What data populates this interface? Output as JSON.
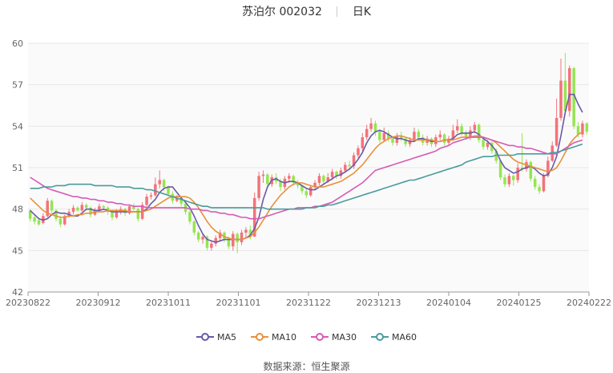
{
  "header": {
    "name": "苏泊尔 002032",
    "period": "日K"
  },
  "source": {
    "label": "数据来源：",
    "value": "恒生聚源"
  },
  "colors": {
    "up": "#f4727a",
    "down": "#95e550",
    "grid": "#e8e8e8",
    "ma5": "#6a5aa8",
    "ma10": "#e8913a",
    "ma30": "#d65bb6",
    "ma60": "#4a9c9c"
  },
  "chart_data": {
    "type": "candlestick",
    "ylim": [
      42,
      60
    ],
    "yticks": [
      "42",
      "45",
      "48",
      "51",
      "54",
      "57",
      "60"
    ],
    "xticks": [
      "20230822",
      "20230912",
      "20231011",
      "20231101",
      "20231122",
      "20231213",
      "20240104",
      "20240125",
      "20240222"
    ],
    "candles": [
      [
        47.9,
        47.3,
        48.0,
        47.1
      ],
      [
        47.4,
        47.1,
        47.6,
        46.9
      ],
      [
        47.2,
        46.9,
        47.4,
        46.8
      ],
      [
        47.0,
        47.5,
        47.7,
        46.9
      ],
      [
        47.5,
        48.6,
        48.8,
        47.4
      ],
      [
        48.6,
        47.9,
        48.7,
        47.7
      ],
      [
        47.9,
        47.3,
        48.0,
        47.1
      ],
      [
        47.3,
        46.9,
        47.5,
        46.7
      ],
      [
        46.9,
        47.5,
        47.6,
        46.8
      ],
      [
        47.5,
        47.8,
        48.0,
        47.4
      ],
      [
        47.8,
        48.1,
        48.3,
        47.6
      ],
      [
        48.1,
        47.9,
        48.2,
        47.8
      ],
      [
        47.9,
        48.3,
        48.5,
        47.8
      ],
      [
        48.3,
        48.1,
        48.4,
        47.9
      ],
      [
        48.1,
        47.6,
        48.2,
        47.4
      ],
      [
        47.6,
        47.9,
        48.1,
        47.5
      ],
      [
        47.9,
        48.2,
        48.4,
        47.8
      ],
      [
        48.2,
        48.1,
        48.3,
        47.9
      ],
      [
        48.1,
        47.8,
        48.2,
        47.6
      ],
      [
        47.8,
        47.4,
        47.9,
        47.2
      ],
      [
        47.4,
        47.8,
        48.0,
        47.3
      ],
      [
        47.8,
        48.0,
        48.2,
        47.6
      ],
      [
        48.0,
        47.7,
        48.1,
        47.5
      ],
      [
        47.7,
        48.2,
        48.3,
        47.6
      ],
      [
        48.2,
        48.0,
        48.4,
        47.9
      ],
      [
        48.0,
        47.3,
        48.1,
        47.1
      ],
      [
        47.3,
        48.3,
        48.5,
        47.2
      ],
      [
        48.3,
        48.9,
        49.1,
        48.1
      ],
      [
        48.9,
        49.0,
        49.2,
        48.7
      ],
      [
        49.0,
        49.8,
        50.3,
        48.9
      ],
      [
        49.8,
        50.1,
        50.8,
        49.5
      ],
      [
        50.1,
        49.6,
        50.2,
        49.3
      ],
      [
        49.6,
        49.1,
        49.7,
        48.9
      ],
      [
        49.1,
        48.6,
        49.3,
        48.4
      ],
      [
        48.6,
        48.8,
        49.0,
        48.5
      ],
      [
        48.8,
        48.4,
        48.9,
        48.2
      ],
      [
        48.4,
        47.8,
        48.5,
        47.6
      ],
      [
        47.8,
        47.1,
        47.9,
        46.9
      ],
      [
        47.1,
        46.3,
        47.2,
        46.1
      ],
      [
        46.3,
        45.8,
        46.4,
        45.6
      ],
      [
        45.8,
        46.0,
        46.2,
        45.5
      ],
      [
        46.0,
        45.2,
        46.1,
        45.0
      ],
      [
        45.2,
        45.5,
        45.7,
        45.0
      ],
      [
        45.5,
        45.9,
        46.1,
        45.3
      ],
      [
        45.9,
        46.3,
        46.5,
        45.7
      ],
      [
        46.3,
        45.8,
        46.4,
        45.6
      ],
      [
        45.8,
        45.3,
        46.0,
        45.1
      ],
      [
        45.3,
        46.2,
        46.4,
        45.0
      ],
      [
        46.2,
        45.6,
        46.3,
        44.8
      ],
      [
        45.6,
        46.3,
        46.5,
        45.4
      ],
      [
        46.3,
        46.5,
        46.7,
        45.9
      ],
      [
        46.5,
        46.0,
        46.8,
        45.8
      ],
      [
        46.0,
        48.8,
        49.2,
        46.0
      ],
      [
        48.8,
        50.4,
        50.7,
        48.6
      ],
      [
        50.4,
        50.5,
        50.8,
        49.9
      ],
      [
        50.5,
        49.8,
        50.6,
        49.5
      ],
      [
        49.8,
        50.3,
        50.5,
        49.6
      ],
      [
        50.3,
        50.0,
        50.6,
        49.8
      ],
      [
        50.0,
        49.6,
        50.2,
        49.3
      ],
      [
        49.6,
        50.2,
        50.4,
        49.4
      ],
      [
        50.2,
        50.4,
        50.6,
        49.9
      ],
      [
        50.4,
        49.9,
        50.5,
        49.7
      ],
      [
        49.9,
        49.7,
        50.1,
        49.5
      ],
      [
        49.7,
        49.3,
        49.8,
        49.1
      ],
      [
        49.3,
        49.0,
        49.5,
        48.8
      ],
      [
        49.0,
        49.6,
        49.7,
        48.9
      ],
      [
        49.6,
        49.9,
        50.1,
        49.4
      ],
      [
        49.9,
        50.4,
        50.6,
        49.7
      ],
      [
        50.4,
        50.0,
        50.5,
        49.8
      ],
      [
        50.0,
        50.3,
        50.6,
        49.9
      ],
      [
        50.3,
        50.7,
        50.9,
        50.1
      ],
      [
        50.7,
        50.4,
        50.8,
        50.2
      ],
      [
        50.4,
        50.8,
        51.0,
        50.2
      ],
      [
        50.8,
        51.2,
        51.4,
        50.6
      ],
      [
        51.2,
        51.1,
        51.5,
        50.9
      ],
      [
        51.1,
        51.9,
        52.1,
        50.9
      ],
      [
        51.9,
        52.4,
        52.6,
        51.7
      ],
      [
        52.4,
        53.2,
        53.5,
        52.2
      ],
      [
        53.2,
        53.8,
        54.1,
        53.0
      ],
      [
        53.8,
        54.2,
        54.6,
        53.6
      ],
      [
        54.2,
        53.6,
        54.4,
        53.3
      ],
      [
        53.6,
        53.0,
        53.8,
        52.8
      ],
      [
        53.0,
        53.5,
        53.9,
        52.9
      ],
      [
        53.5,
        53.1,
        53.7,
        52.9
      ],
      [
        53.1,
        52.8,
        53.3,
        52.6
      ],
      [
        52.8,
        53.3,
        53.5,
        52.6
      ],
      [
        53.3,
        53.1,
        53.6,
        52.9
      ],
      [
        53.1,
        52.7,
        53.2,
        52.5
      ],
      [
        52.7,
        53.0,
        53.2,
        52.5
      ],
      [
        53.0,
        53.6,
        53.9,
        52.9
      ],
      [
        53.6,
        53.2,
        53.8,
        53.0
      ],
      [
        53.2,
        52.8,
        53.4,
        52.6
      ],
      [
        52.8,
        53.1,
        53.3,
        52.6
      ],
      [
        53.1,
        52.7,
        53.2,
        52.5
      ],
      [
        52.7,
        53.2,
        53.4,
        52.5
      ],
      [
        53.2,
        53.4,
        53.7,
        53.0
      ],
      [
        53.4,
        52.8,
        53.5,
        52.6
      ],
      [
        52.8,
        53.1,
        53.3,
        52.6
      ],
      [
        53.1,
        53.7,
        54.1,
        53.0
      ],
      [
        53.7,
        54.0,
        54.5,
        53.5
      ],
      [
        54.0,
        53.5,
        54.2,
        53.3
      ],
      [
        53.5,
        53.2,
        53.7,
        53.0
      ],
      [
        53.2,
        53.7,
        54.0,
        53.0
      ],
      [
        53.7,
        54.1,
        54.3,
        53.5
      ],
      [
        54.1,
        53.0,
        54.2,
        52.8
      ],
      [
        53.0,
        52.5,
        53.2,
        52.3
      ],
      [
        52.5,
        52.8,
        53.0,
        52.3
      ],
      [
        52.8,
        52.2,
        52.9,
        52.0
      ],
      [
        52.2,
        51.5,
        52.4,
        51.3
      ],
      [
        51.5,
        50.3,
        51.6,
        50.1
      ],
      [
        50.3,
        49.8,
        50.5,
        49.6
      ],
      [
        49.8,
        50.4,
        50.6,
        49.6
      ],
      [
        50.4,
        50.1,
        50.5,
        49.7
      ],
      [
        50.1,
        51.0,
        51.3,
        49.9
      ],
      [
        51.0,
        50.9,
        53.5,
        50.7
      ],
      [
        50.9,
        51.4,
        51.6,
        50.7
      ],
      [
        51.4,
        50.2,
        51.5,
        50.0
      ],
      [
        50.2,
        49.6,
        50.4,
        49.4
      ],
      [
        49.6,
        49.3,
        49.8,
        49.1
      ],
      [
        49.3,
        50.4,
        50.6,
        49.2
      ],
      [
        50.4,
        51.5,
        51.8,
        50.3
      ],
      [
        51.5,
        52.6,
        52.9,
        51.4
      ],
      [
        52.6,
        54.6,
        56.0,
        52.5
      ],
      [
        54.6,
        57.3,
        58.9,
        54.4
      ],
      [
        57.3,
        55.1,
        59.3,
        54.9
      ],
      [
        55.1,
        58.2,
        58.4,
        54.7
      ],
      [
        58.2,
        54.0,
        58.3,
        53.8
      ],
      [
        54.0,
        53.4,
        54.3,
        53.2
      ],
      [
        53.4,
        54.2,
        54.4,
        53.2
      ],
      [
        54.2,
        53.6,
        54.3,
        53.4
      ]
    ],
    "series": [
      {
        "name": "MA5",
        "values": [
          47.9,
          47.6,
          47.3,
          47.2,
          47.3,
          47.6,
          47.8,
          47.7,
          47.7,
          47.6,
          47.5,
          47.5,
          47.7,
          48.0,
          48.0,
          47.9,
          47.9,
          48.0,
          47.9,
          47.8,
          47.8,
          47.8,
          47.8,
          47.8,
          47.8,
          47.8,
          47.8,
          48.0,
          48.4,
          48.7,
          49.2,
          49.5,
          49.6,
          49.6,
          49.2,
          48.8,
          48.5,
          48.1,
          47.5,
          46.8,
          46.2,
          45.8,
          45.7,
          45.6,
          45.7,
          45.8,
          45.8,
          45.8,
          45.8,
          45.8,
          45.9,
          46.1,
          46.6,
          47.4,
          48.7,
          49.6,
          50.1,
          50.2,
          50.0,
          49.9,
          50.0,
          50.0,
          49.9,
          49.7,
          49.5,
          49.4,
          49.4,
          49.6,
          49.8,
          50.0,
          50.2,
          50.4,
          50.5,
          50.7,
          50.9,
          51.2,
          51.6,
          52.1,
          52.8,
          53.3,
          53.6,
          53.7,
          53.6,
          53.4,
          53.2,
          53.1,
          53.1,
          53.0,
          52.9,
          52.9,
          53.1,
          53.1,
          53.0,
          52.9,
          52.9,
          52.9,
          53.0,
          53.0,
          53.1,
          53.4,
          53.5,
          53.5,
          53.5,
          53.6,
          53.4,
          53.1,
          52.9,
          52.6,
          52.2,
          51.5,
          51.0,
          50.8,
          50.6,
          50.7,
          50.9,
          51.0,
          51.1,
          50.9,
          50.6,
          50.4,
          50.5,
          51.0,
          51.8,
          53.3,
          55.0,
          56.3,
          56.3,
          55.6,
          55.0
        ]
      },
      {
        "name": "MA10",
        "values": [
          48.8,
          48.5,
          48.2,
          47.9,
          47.7,
          47.6,
          47.5,
          47.4,
          47.4,
          47.5,
          47.5,
          47.6,
          47.6,
          47.7,
          47.7,
          47.8,
          47.8,
          47.8,
          47.9,
          47.9,
          47.9,
          47.9,
          47.9,
          47.8,
          47.8,
          47.8,
          47.8,
          47.9,
          48.0,
          48.2,
          48.4,
          48.6,
          48.8,
          48.9,
          48.9,
          48.9,
          48.9,
          48.8,
          48.5,
          48.1,
          47.6,
          47.1,
          46.7,
          46.4,
          46.2,
          46.0,
          45.9,
          45.8,
          45.8,
          45.8,
          45.9,
          46.0,
          46.3,
          46.7,
          47.2,
          47.7,
          48.2,
          48.6,
          49.0,
          49.3,
          49.6,
          49.8,
          49.9,
          49.9,
          49.8,
          49.7,
          49.6,
          49.6,
          49.6,
          49.7,
          49.8,
          49.9,
          50.0,
          50.2,
          50.4,
          50.6,
          50.9,
          51.2,
          51.6,
          52.0,
          52.4,
          52.7,
          52.9,
          53.1,
          53.2,
          53.3,
          53.3,
          53.2,
          53.1,
          53.0,
          53.0,
          53.0,
          53.0,
          53.0,
          52.9,
          52.9,
          53.0,
          53.0,
          53.0,
          53.1,
          53.2,
          53.2,
          53.2,
          53.3,
          53.3,
          53.2,
          53.1,
          53.0,
          52.8,
          52.5,
          52.2,
          51.9,
          51.6,
          51.4,
          51.3,
          51.2,
          51.1,
          51.0,
          50.9,
          50.8,
          50.7,
          50.8,
          51.0,
          51.5,
          52.1,
          52.7,
          53.1,
          53.4,
          53.6
        ]
      },
      {
        "name": "MA30",
        "values": [
          50.3,
          50.1,
          49.9,
          49.7,
          49.5,
          49.4,
          49.3,
          49.2,
          49.1,
          49.0,
          48.9,
          48.9,
          48.8,
          48.8,
          48.7,
          48.7,
          48.6,
          48.6,
          48.5,
          48.5,
          48.4,
          48.4,
          48.3,
          48.3,
          48.2,
          48.2,
          48.2,
          48.1,
          48.1,
          48.1,
          48.1,
          48.1,
          48.1,
          48.1,
          48.1,
          48.1,
          48.1,
          48.0,
          48.0,
          48.0,
          47.9,
          47.9,
          47.8,
          47.8,
          47.7,
          47.7,
          47.6,
          47.6,
          47.5,
          47.4,
          47.4,
          47.3,
          47.3,
          47.3,
          47.4,
          47.5,
          47.6,
          47.7,
          47.8,
          47.9,
          48.0,
          48.0,
          48.1,
          48.1,
          48.1,
          48.1,
          48.2,
          48.2,
          48.3,
          48.4,
          48.5,
          48.7,
          48.9,
          49.1,
          49.3,
          49.5,
          49.7,
          49.9,
          50.2,
          50.5,
          50.8,
          50.9,
          51.0,
          51.1,
          51.2,
          51.3,
          51.4,
          51.5,
          51.6,
          51.7,
          51.8,
          51.9,
          52.0,
          52.1,
          52.2,
          52.4,
          52.5,
          52.6,
          52.8,
          52.9,
          53.0,
          53.1,
          53.2,
          53.2,
          53.2,
          53.2,
          53.1,
          53.0,
          52.9,
          52.8,
          52.7,
          52.6,
          52.6,
          52.5,
          52.5,
          52.4,
          52.4,
          52.3,
          52.2,
          52.1,
          52.0,
          52.0,
          52.0,
          52.2,
          52.4,
          52.6,
          52.8,
          52.9,
          53.0
        ]
      },
      {
        "name": "MA60",
        "values": [
          49.5,
          49.5,
          49.5,
          49.6,
          49.6,
          49.6,
          49.7,
          49.7,
          49.7,
          49.8,
          49.8,
          49.8,
          49.8,
          49.8,
          49.8,
          49.7,
          49.7,
          49.7,
          49.7,
          49.7,
          49.6,
          49.6,
          49.6,
          49.6,
          49.5,
          49.5,
          49.5,
          49.4,
          49.4,
          49.3,
          49.2,
          49.1,
          49.0,
          48.9,
          48.8,
          48.7,
          48.6,
          48.5,
          48.4,
          48.3,
          48.2,
          48.2,
          48.1,
          48.1,
          48.1,
          48.1,
          48.1,
          48.1,
          48.1,
          48.1,
          48.1,
          48.1,
          48.1,
          48.1,
          48.1,
          48.0,
          48.0,
          48.0,
          48.0,
          48.0,
          48.0,
          48.0,
          48.0,
          48.0,
          48.1,
          48.1,
          48.1,
          48.2,
          48.2,
          48.3,
          48.3,
          48.4,
          48.5,
          48.6,
          48.7,
          48.8,
          48.9,
          49.0,
          49.1,
          49.2,
          49.3,
          49.4,
          49.5,
          49.6,
          49.7,
          49.8,
          49.9,
          50.0,
          50.1,
          50.1,
          50.2,
          50.3,
          50.4,
          50.5,
          50.6,
          50.7,
          50.8,
          50.9,
          51.0,
          51.1,
          51.2,
          51.4,
          51.5,
          51.6,
          51.7,
          51.8,
          51.8,
          51.8,
          51.9,
          51.9,
          51.9,
          51.9,
          51.9,
          52.0,
          52.0,
          52.0,
          52.0,
          52.0,
          52.0,
          52.0,
          52.0,
          52.1,
          52.1,
          52.2,
          52.3,
          52.4,
          52.5,
          52.6,
          52.7
        ]
      }
    ]
  }
}
